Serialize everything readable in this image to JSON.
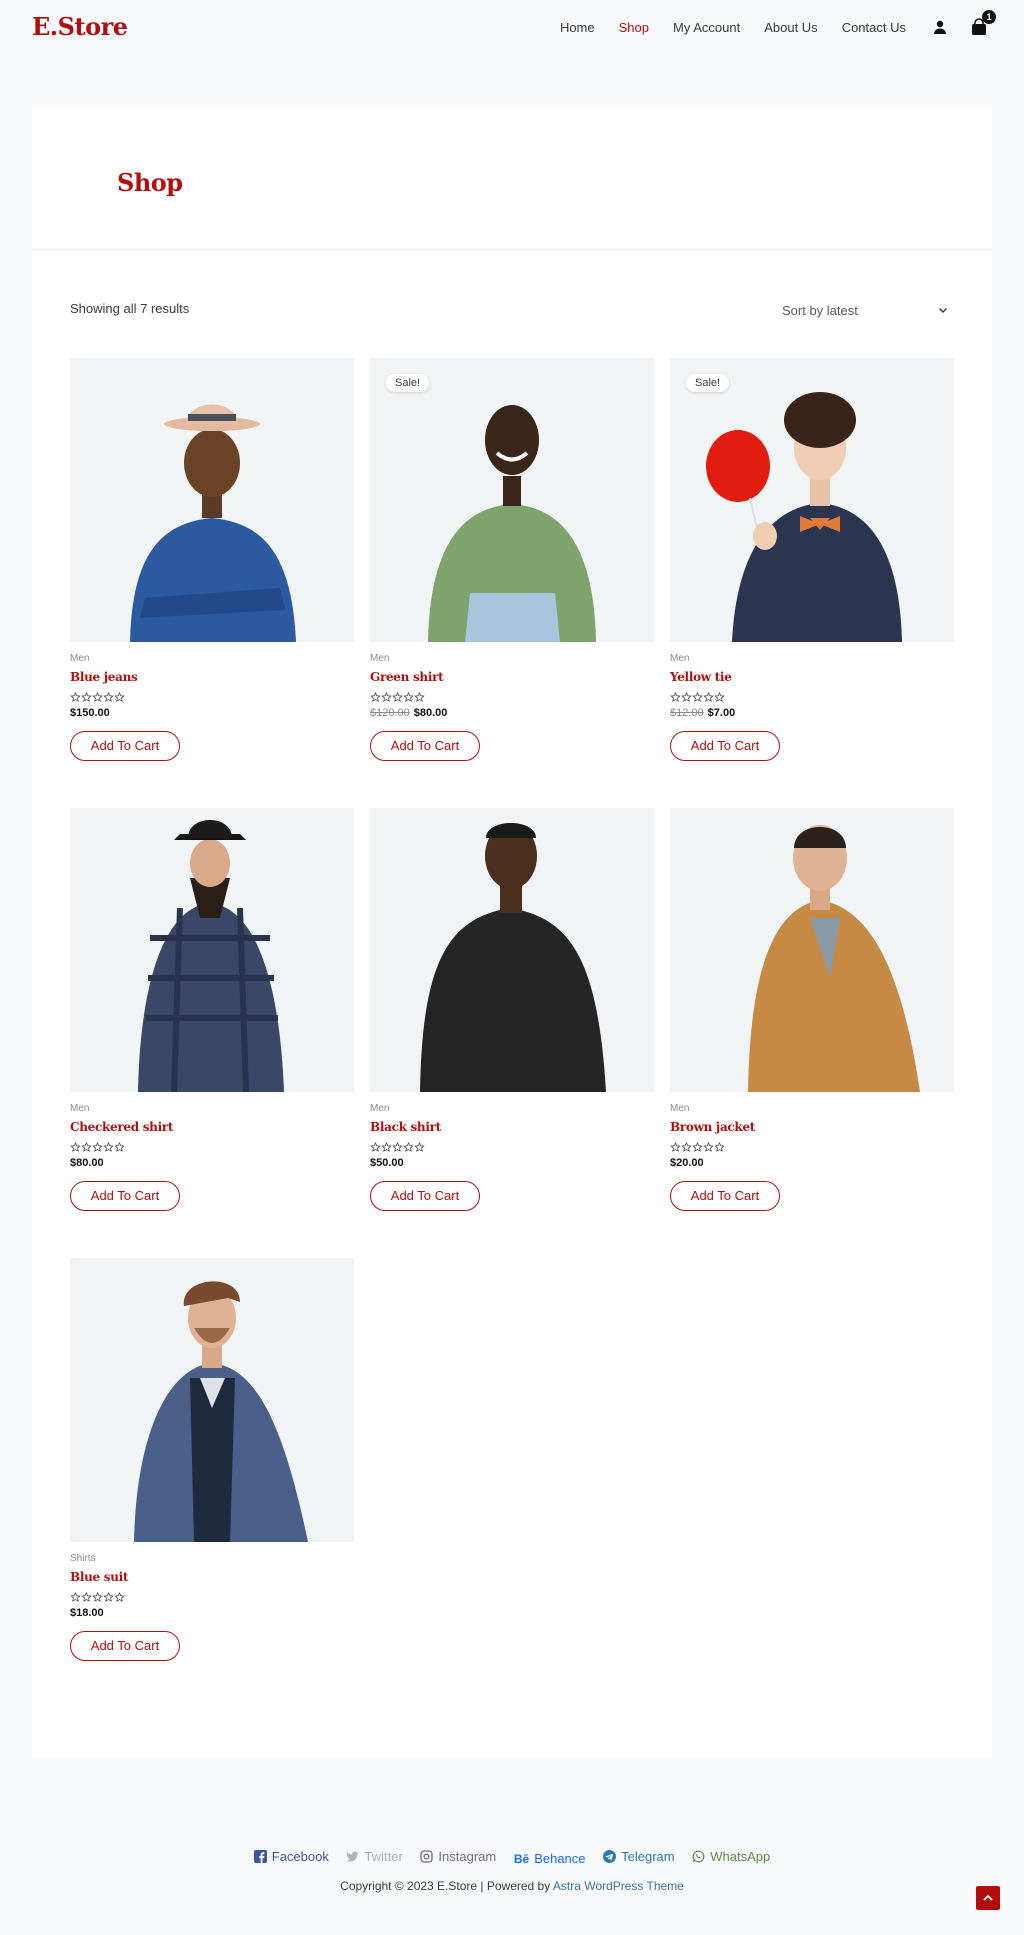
{
  "header": {
    "logo": "E.Store",
    "nav": [
      {
        "label": "Home",
        "active": false
      },
      {
        "label": "Shop",
        "active": true
      },
      {
        "label": "My Account",
        "active": false
      },
      {
        "label": "About Us",
        "active": false
      },
      {
        "label": "Contact Us",
        "active": false
      }
    ],
    "cart_count": "1"
  },
  "page": {
    "title": "Shop",
    "result_count": "Showing all 7 results",
    "sort_label": "Sort by latest"
  },
  "products": [
    {
      "category": "Men",
      "name": "Blue jeans",
      "old_price": "",
      "price": "$150.00",
      "sale": "",
      "button": "Add To Cart",
      "rating": 0
    },
    {
      "category": "Men",
      "name": "Green shirt",
      "old_price": "$120.00",
      "price": "$80.00",
      "sale": "Sale!",
      "button": "Add To Cart",
      "rating": 0
    },
    {
      "category": "Men",
      "name": "Yellow tie",
      "old_price": "$12.00",
      "price": "$7.00",
      "sale": "Sale!",
      "button": "Add To Cart",
      "rating": 0
    },
    {
      "category": "Men",
      "name": "Checkered shirt",
      "old_price": "",
      "price": "$80.00",
      "sale": "",
      "button": "Add To Cart",
      "rating": 0
    },
    {
      "category": "Men",
      "name": "Black shirt",
      "old_price": "",
      "price": "$50.00",
      "sale": "",
      "button": "Add To Cart",
      "rating": 0
    },
    {
      "category": "Men",
      "name": "Brown jacket",
      "old_price": "",
      "price": "$20.00",
      "sale": "",
      "button": "Add To Cart",
      "rating": 0
    },
    {
      "category": "Shirts",
      "name": "Blue suit",
      "old_price": "",
      "price": "$18.00",
      "sale": "",
      "button": "Add To Cart",
      "rating": 0
    }
  ],
  "footer": {
    "social": [
      {
        "label": "Facebook",
        "icon": "facebook-icon",
        "color": "#3b5998"
      },
      {
        "label": "Twitter",
        "icon": "twitter-icon",
        "color": "#9fb6c8"
      },
      {
        "label": "Instagram",
        "icon": "instagram-icon",
        "color": "#6b6b8a"
      },
      {
        "label": "Behance",
        "icon": "behance-icon",
        "color": "#1769ff"
      },
      {
        "label": "Telegram",
        "icon": "telegram-icon",
        "color": "#2a7ab0"
      },
      {
        "label": "WhatsApp",
        "icon": "whatsapp-icon",
        "color": "#5c8a4a"
      }
    ],
    "copyright_prefix": "Copyright © 2023 E.Store | Powered by ",
    "copyright_link": "Astra WordPress Theme"
  },
  "colors": {
    "accent": "#b30e0e",
    "thumb_bg": "#f1f4f5",
    "page_bg": "#f8f9fb"
  }
}
